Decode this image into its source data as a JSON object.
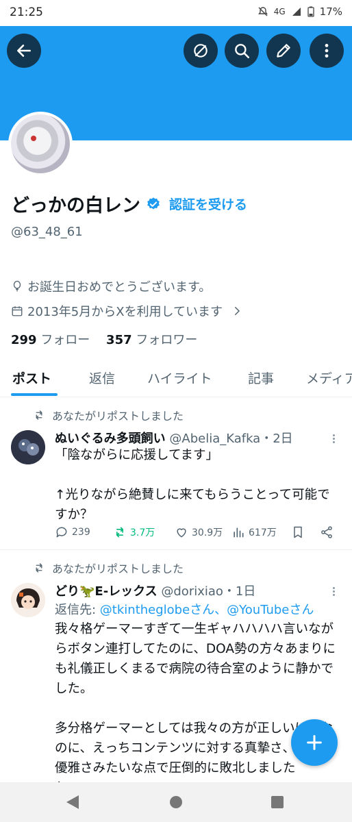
{
  "status_bar": {
    "time": "21:25",
    "network": "4G",
    "battery": "17%"
  },
  "header": {
    "back_icon": "arrow-left-icon",
    "translate_icon": "translate-icon",
    "search_icon": "search-icon",
    "edit_icon": "pencil-icon",
    "more_icon": "more-vertical-icon",
    "banner_color": "#1d9bf0"
  },
  "profile": {
    "display_name": "どっかの白レン",
    "verify_link": "認証を受ける",
    "handle": "@63_48_61",
    "birthday_text": "お誕生日おめでとうございます。",
    "joined_text": "2013年5月からXを利用しています",
    "following_count": "299",
    "following_label": "フォロー",
    "followers_count": "357",
    "followers_label": "フォロワー"
  },
  "tabs": [
    {
      "label": "ポスト",
      "active": true
    },
    {
      "label": "返信",
      "active": false
    },
    {
      "label": "ハイライト",
      "active": false
    },
    {
      "label": "記事",
      "active": false
    },
    {
      "label": "メディア",
      "active": false
    }
  ],
  "posts": [
    {
      "repost_label": "あなたがリポストしました",
      "display_name": "ぬいぐるみ多頭飼い",
      "handle_time": "@Abelia_Kafka・2日",
      "text": "「陰ながらに応援してます」\n\n↑光りながら絶賛しに来てもらうことって可能ですか？",
      "replies": "239",
      "reposts": "3.7万",
      "likes": "30.9万",
      "views": "617万"
    },
    {
      "repost_label": "あなたがリポストしました",
      "display_name": "どり🦖E-レックス",
      "handle_time": "@dorixiao・1日",
      "reply_to_prefix": "返信先: ",
      "reply_to_links": "@tkintheglobeさん、@YouTubeさん",
      "text": "我々格ゲーマーすぎて一生ギャハハハハ言いながらボタン連打してたのに、DOA勢の方々あまりにも礼儀正しくまるで病院の待合室のように静かでした。\n\n多分格ゲーマーとしては我々の方が正しいはずなのに、えっちコンテンツに対する真摯さ、気品、優雅さみたいな点で圧倒的に敗北しました\nね"
    }
  ],
  "fab": {
    "icon": "plus-icon"
  },
  "nav": {
    "back_icon": "nav-back-icon",
    "home_icon": "nav-home-icon",
    "recents_icon": "nav-recents-icon"
  }
}
